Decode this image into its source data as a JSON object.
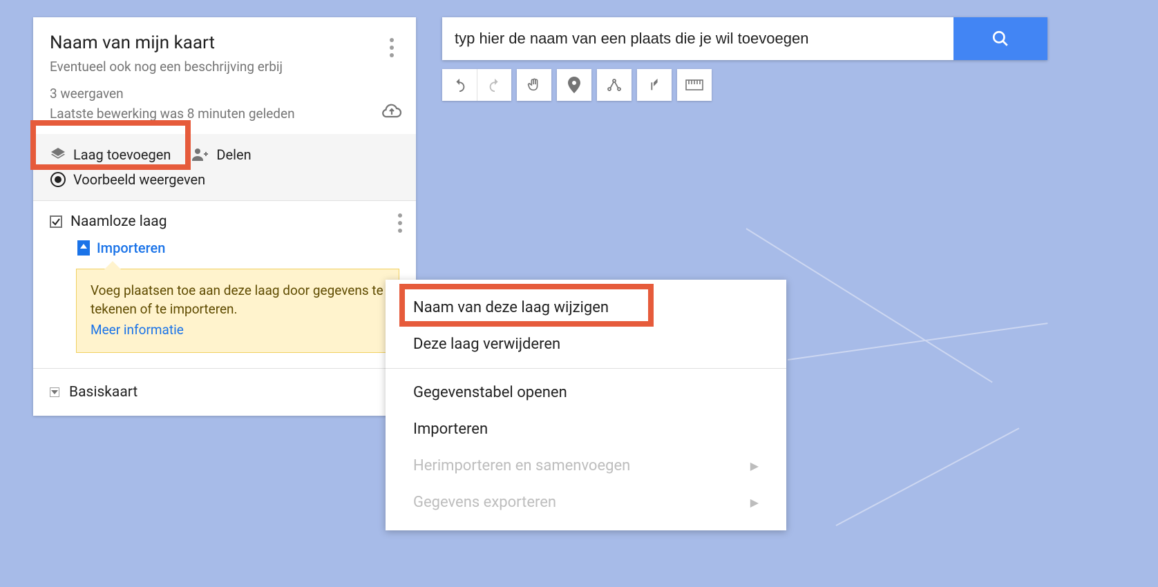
{
  "panel": {
    "title": "Naam van mijn kaart",
    "description": "Eventueel ook nog een beschrijving erbij",
    "views": "3 weergaven",
    "last_edit": "Laatste bewerking was 8 minuten geleden"
  },
  "actions": {
    "add_layer": "Laag toevoegen",
    "share": "Delen",
    "preview": "Voorbeeld weergeven"
  },
  "layer": {
    "name": "Naamloze laag",
    "import": "Importeren"
  },
  "tip": {
    "text": "Voeg plaatsen toe aan deze laag door gegevens te tekenen of te importeren.",
    "more": "Meer informatie"
  },
  "basemap": "Basiskaart",
  "search": {
    "placeholder": "typ hier de naam van een plaats die je wil toevoegen"
  },
  "context_menu": {
    "rename": "Naam van deze laag wijzigen",
    "delete": "Deze laag verwijderen",
    "open_table": "Gegevenstabel openen",
    "import": "Importeren",
    "reimport": "Herimporteren en samenvoegen",
    "export": "Gegevens exporteren"
  }
}
